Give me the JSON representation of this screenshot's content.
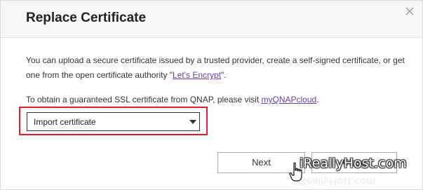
{
  "dialog": {
    "title": "Replace Certificate",
    "close_glyph": "×"
  },
  "body": {
    "p1_text": "You can upload a secure certificate issued by a trusted provider, create a self-signed certificate, or get one from the open certificate authority \"",
    "p1_link": "Let's Encrypt",
    "p1_end": "\".",
    "p2_text": "To obtain a guaranteed SSL certificate from QNAP, please visit ",
    "p2_link": "myQNAPcloud",
    "p2_end": "."
  },
  "select": {
    "value": "Import certificate"
  },
  "buttons": {
    "next": "Next",
    "close": "Close"
  },
  "watermark": {
    "text": "iReallyHost.com"
  },
  "colors": {
    "highlight": "#e01e2a",
    "link": "#6a3ea1",
    "header_bg": "#f7f7f7"
  },
  "icons": {
    "close": "close-icon",
    "dropdown": "chevron-down-icon",
    "cursor": "hand-pointer-icon"
  }
}
